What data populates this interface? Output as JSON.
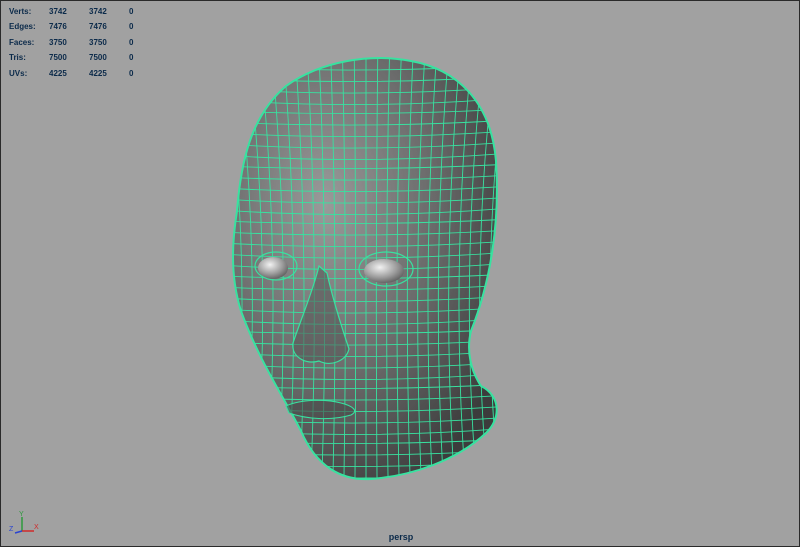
{
  "hud": {
    "rows": [
      {
        "label": "Verts:",
        "total": "3742",
        "visible": "3742",
        "selected": "0"
      },
      {
        "label": "Edges:",
        "total": "7476",
        "visible": "7476",
        "selected": "0"
      },
      {
        "label": "Faces:",
        "total": "3750",
        "visible": "3750",
        "selected": "0"
      },
      {
        "label": "Tris:",
        "total": "7500",
        "visible": "7500",
        "selected": "0"
      },
      {
        "label": "UVs:",
        "total": "4225",
        "visible": "4225",
        "selected": "0"
      }
    ]
  },
  "viewport": {
    "camera": "persp",
    "background_color": "#a1a1a1",
    "wire_color": "#38e2a0",
    "mesh_color": "#5f5f5f"
  },
  "axis": {
    "y_label": "Y",
    "x_label": "X",
    "z_label": "Z",
    "y_color": "#2c9a3c",
    "x_color": "#d02a2a",
    "z_color": "#2a44d0"
  }
}
